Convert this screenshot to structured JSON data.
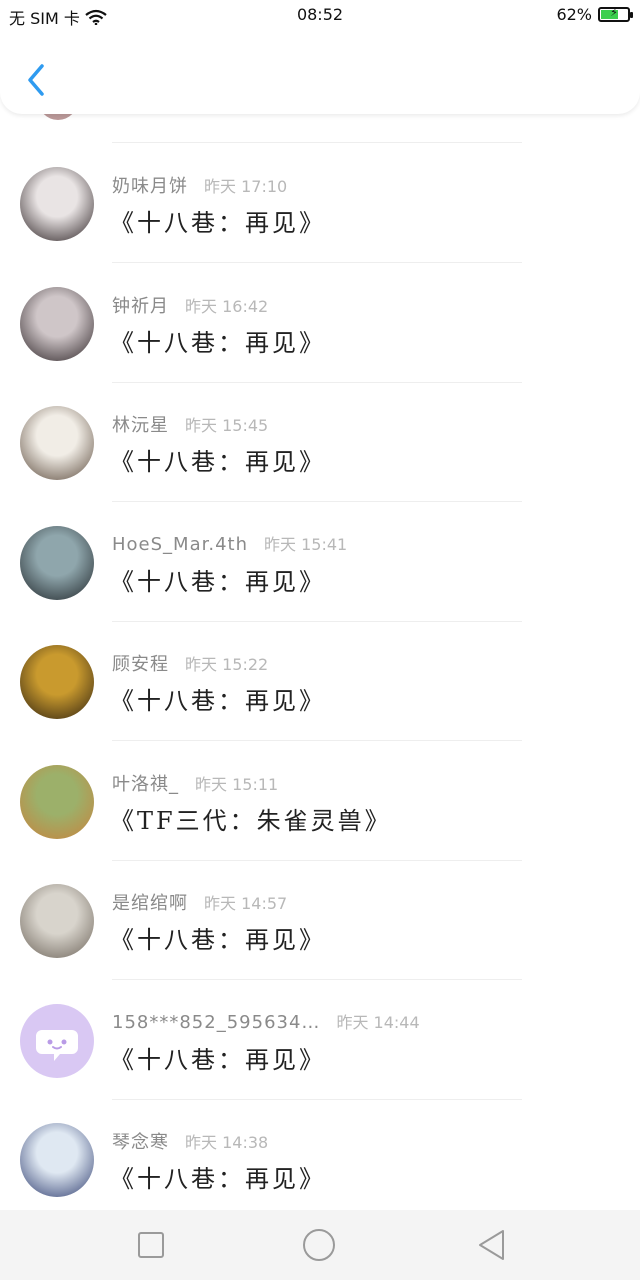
{
  "status_bar": {
    "carrier": "无 SIM 卡",
    "time": "08:52",
    "battery": "62%",
    "battery_level": 0.62
  },
  "header": {
    "back_icon": "chevron-left-icon"
  },
  "list": [
    {
      "name": "奶味月饼",
      "time": "昨天 17:10",
      "title": "《十八巷：再见》",
      "avatar_colors": [
        "#e9e4e4",
        "#2a2022"
      ]
    },
    {
      "name": "钟祈月",
      "time": "昨天 16:42",
      "title": "《十八巷：再见》",
      "avatar_colors": [
        "#cfc6c8",
        "#2c2326"
      ]
    },
    {
      "name": "林沅星",
      "time": "昨天 15:45",
      "title": "《十八巷：再见》",
      "avatar_colors": [
        "#f1ede6",
        "#5b4a3c"
      ]
    },
    {
      "name": "HoeS_Mar.4th",
      "time": "昨天 15:41",
      "title": "《十八巷：再见》",
      "avatar_colors": [
        "#8fa6ac",
        "#1e2428"
      ]
    },
    {
      "name": "顾安程",
      "time": "昨天 15:22",
      "title": "《十八巷：再见》",
      "avatar_colors": [
        "#c99a2e",
        "#2d2010"
      ]
    },
    {
      "name": "叶洛祺_",
      "time": "昨天 15:11",
      "title": "《TF三代：朱雀灵兽》",
      "avatar_colors": [
        "#9cb06a",
        "#c9823c"
      ]
    },
    {
      "name": "是绾绾啊",
      "time": "昨天 14:57",
      "title": "《十八巷：再见》",
      "avatar_colors": [
        "#d8d4cc",
        "#6b6258"
      ]
    },
    {
      "name": "158***852_595634…",
      "time": "昨天 14:44",
      "title": "《十八巷：再见》",
      "avatar_colors": [
        "#d9c8f3",
        "#ffffff"
      ]
    },
    {
      "name": "琴念寒",
      "time": "昨天 14:38",
      "title": "《十八巷：再见》",
      "avatar_colors": [
        "#dfe8f2",
        "#2d3b6e"
      ]
    }
  ],
  "nav_bar": {
    "recent_icon": "square-icon",
    "home_icon": "circle-icon",
    "back_icon": "triangle-back-icon"
  }
}
